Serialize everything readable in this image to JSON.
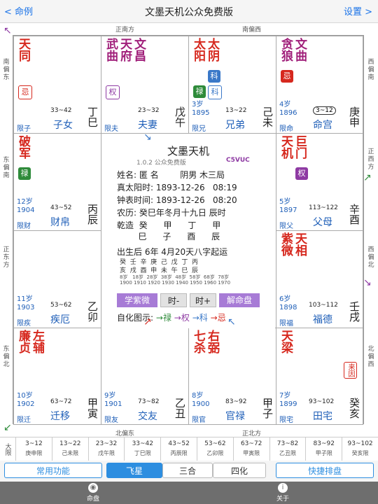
{
  "topbar": {
    "back_label": "命例",
    "title": "文墨天机公众免费版",
    "settings_label": "设置"
  },
  "directions": {
    "top": [
      "正南方",
      "南偏西"
    ],
    "bottom": [
      "北偏东",
      "正北方"
    ],
    "left": [
      "南偏东",
      "东偏南",
      "正东方",
      "东偏北"
    ],
    "right": [
      "西偏南",
      "正西方",
      "西偏北",
      "北偏西"
    ]
  },
  "palaces": {
    "si": {
      "stars": [
        "天同"
      ],
      "mutagens": [
        "忌"
      ],
      "range": "33~42",
      "palace": "子女",
      "boshi": "限子",
      "gz": "丁巳"
    },
    "wu": {
      "stars": [
        "武曲",
        "天府",
        "文昌"
      ],
      "mutagens": [
        "权"
      ],
      "range": "23~32",
      "palace": "夫妻",
      "boshi": "限夫",
      "gz": "戊午"
    },
    "wei": {
      "stars": [
        "太阳",
        "太阴"
      ],
      "mutagens": [
        "科",
        "禄",
        "科"
      ],
      "age": "3岁",
      "year": "1895",
      "range": "13~22",
      "palace": "兄弟",
      "boshi": "限兄",
      "gz": "己未"
    },
    "shen": {
      "stars": [
        "贪狼",
        "文曲"
      ],
      "mutagens": [
        "忌"
      ],
      "age": "4岁",
      "year": "1896",
      "range": "3~12",
      "palace": "命宫",
      "boshi": "限命",
      "gz": "庚申"
    },
    "chen": {
      "stars": [
        "破军"
      ],
      "mutagens": [
        "禄"
      ],
      "age": "12岁",
      "year": "1904",
      "range": "43~52",
      "palace": "财帛",
      "boshi": "限财",
      "gz": "丙辰"
    },
    "you": {
      "stars": [
        "天机",
        "巨门"
      ],
      "mutagens": [
        "权"
      ],
      "age": "5岁",
      "year": "1897",
      "range": "113~122",
      "palace": "父母",
      "boshi": "限父",
      "gz": "辛酉"
    },
    "mao": {
      "stars": [],
      "mutagens": [],
      "age": "11岁",
      "year": "1903",
      "range": "53~62",
      "palace": "疾厄",
      "boshi": "限疾",
      "gz": "乙卯"
    },
    "xu": {
      "stars": [
        "紫微",
        "天相"
      ],
      "mutagens": [],
      "age": "6岁",
      "year": "1898",
      "range": "103~112",
      "palace": "福德",
      "boshi": "限福",
      "gz": "壬戌"
    },
    "yin": {
      "stars": [
        "廉贞",
        "左辅"
      ],
      "mutagens": [],
      "age": "10岁",
      "year": "1902",
      "range": "63~72",
      "palace": "迁移",
      "boshi": "限迁",
      "gz": "甲寅"
    },
    "chou": {
      "stars": [],
      "mutagens": [],
      "age": "9岁",
      "year": "1901",
      "range": "73~82",
      "palace": "交友",
      "boshi": "限友",
      "gz": "乙丑"
    },
    "zi": {
      "stars": [
        "七杀",
        "右弼"
      ],
      "mutagens": [],
      "age": "8岁",
      "year": "1900",
      "range": "83~92",
      "palace": "官禄",
      "boshi": "限官",
      "gz": "甲子"
    },
    "hai": {
      "stars": [
        "天梁"
      ],
      "mutagens": [],
      "laiyin": "来因",
      "age": "7岁",
      "year": "1899",
      "range": "93~102",
      "palace": "田宅",
      "boshi": "限宅",
      "gz": "癸亥"
    }
  },
  "center": {
    "title": "文墨天机",
    "version": "1.0.2 公众免费版",
    "code": "C5VUC",
    "line_name": "姓名: 匿 名        阴男 木三局",
    "line_solar": "真太阳时: 1893-12-26   08:19",
    "line_clock": "钟表时间: 1893-12-26   08:20",
    "line_lunar": "农历: 癸巳年冬月十九日 辰时",
    "line_bazi1": "乾造  癸      甲      丁      甲",
    "line_bazi2": "        巳      子      酉      辰",
    "line_yun": "出生后 6年 4月20天八字起运",
    "dayun_row1": "癸  壬  辛  庚  己  戊  丁  丙",
    "dayun_row2": "亥  戌  酉  申  未  午  巳  辰",
    "dayun_ages": "8岁   18岁  28岁  38岁  48岁  58岁  68岁  78岁",
    "dayun_years": "1900 1910 1920 1930 1940 1950 1960 1970",
    "btn_xueziwei": "学紫微",
    "btn_prev": "时-",
    "btn_next": "时+",
    "btn_jie": "解命盘",
    "legend_label": "自化图示:",
    "legend_lu": "禄",
    "legend_quan": "权",
    "legend_ke": "科",
    "legend_ji": "忌"
  },
  "decade_bar": {
    "label": "大限",
    "items": [
      {
        "range": "3~12",
        "name": "庚申限"
      },
      {
        "range": "13~22",
        "name": "己未限"
      },
      {
        "range": "23~32",
        "name": "戊午限"
      },
      {
        "range": "33~42",
        "name": "丁巳限"
      },
      {
        "range": "43~52",
        "name": "丙辰限"
      },
      {
        "range": "53~62",
        "name": "乙卯限"
      },
      {
        "range": "63~72",
        "name": "甲寅限"
      },
      {
        "range": "73~82",
        "name": "乙丑限"
      },
      {
        "range": "83~92",
        "name": "甲子限"
      },
      {
        "range": "93~102",
        "name": "癸亥限"
      }
    ]
  },
  "segbar": {
    "common": "常用功能",
    "feixing": "飞星",
    "sanhe": "三合",
    "sihua": "四化",
    "quick": "快捷排盘"
  },
  "tabbar": {
    "mingpan": "命盘",
    "about": "关于"
  },
  "colors": {
    "accent": "#2d8ee0",
    "lu": "#2e8b3a",
    "quan": "#8e3aa3",
    "ke": "#3a78c8",
    "ji": "#d6281e",
    "star_main": "#d6281e",
    "star_alt": "#a01f7a"
  }
}
